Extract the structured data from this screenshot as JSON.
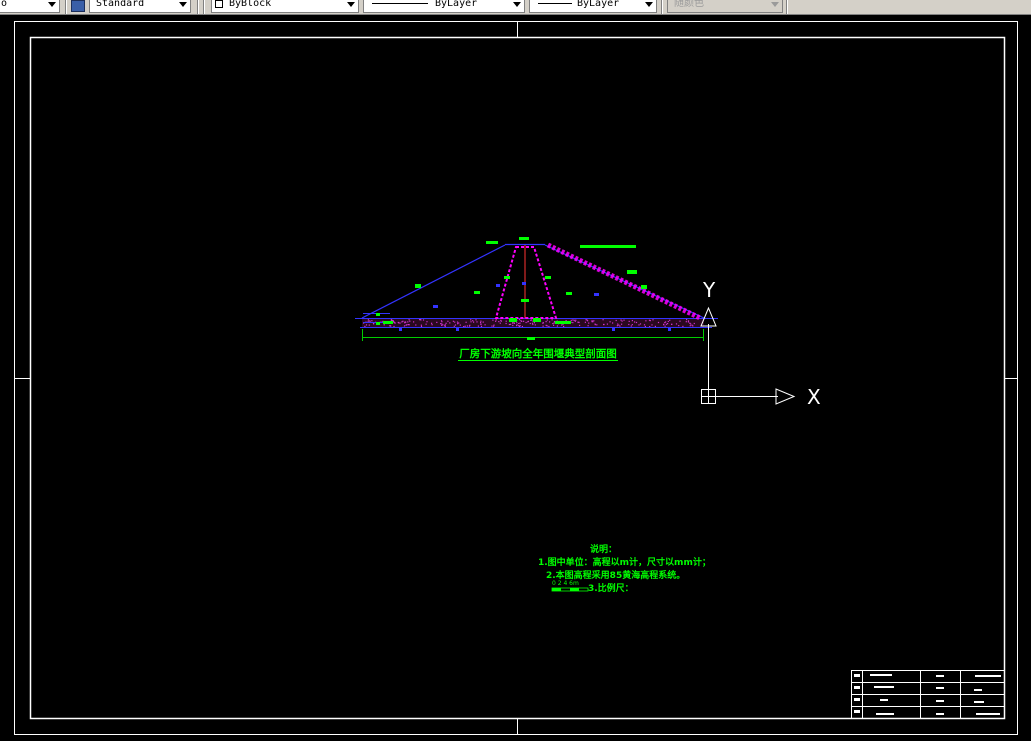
{
  "toolbar": {
    "first_combo_value": "o",
    "text_style_value": "Standard",
    "linetype_value": "ByBlock",
    "lineweight_value": "ByLayer",
    "plotstyle_value": "ByLayer",
    "color_value": "随颜色"
  },
  "drawing": {
    "section_title": "厂房下游坡向全年围堰典型剖面图",
    "axis_x_label": "X",
    "axis_y_label": "Y",
    "notes": {
      "heading": "说明：",
      "line1": "1.图中单位：高程以m计，尺寸以mm计；",
      "line2": "2.本图高程采用85黄海高程系统。",
      "line3": "3.比例尺：",
      "scale_ticks": "0  2  4  6m"
    }
  },
  "colors": {
    "background": "#000000",
    "border": "#ffffff",
    "section_lines": "#3333ff",
    "labels": "#00ff00",
    "riprap": "#ff00ff",
    "centerline": "#ff3333"
  }
}
